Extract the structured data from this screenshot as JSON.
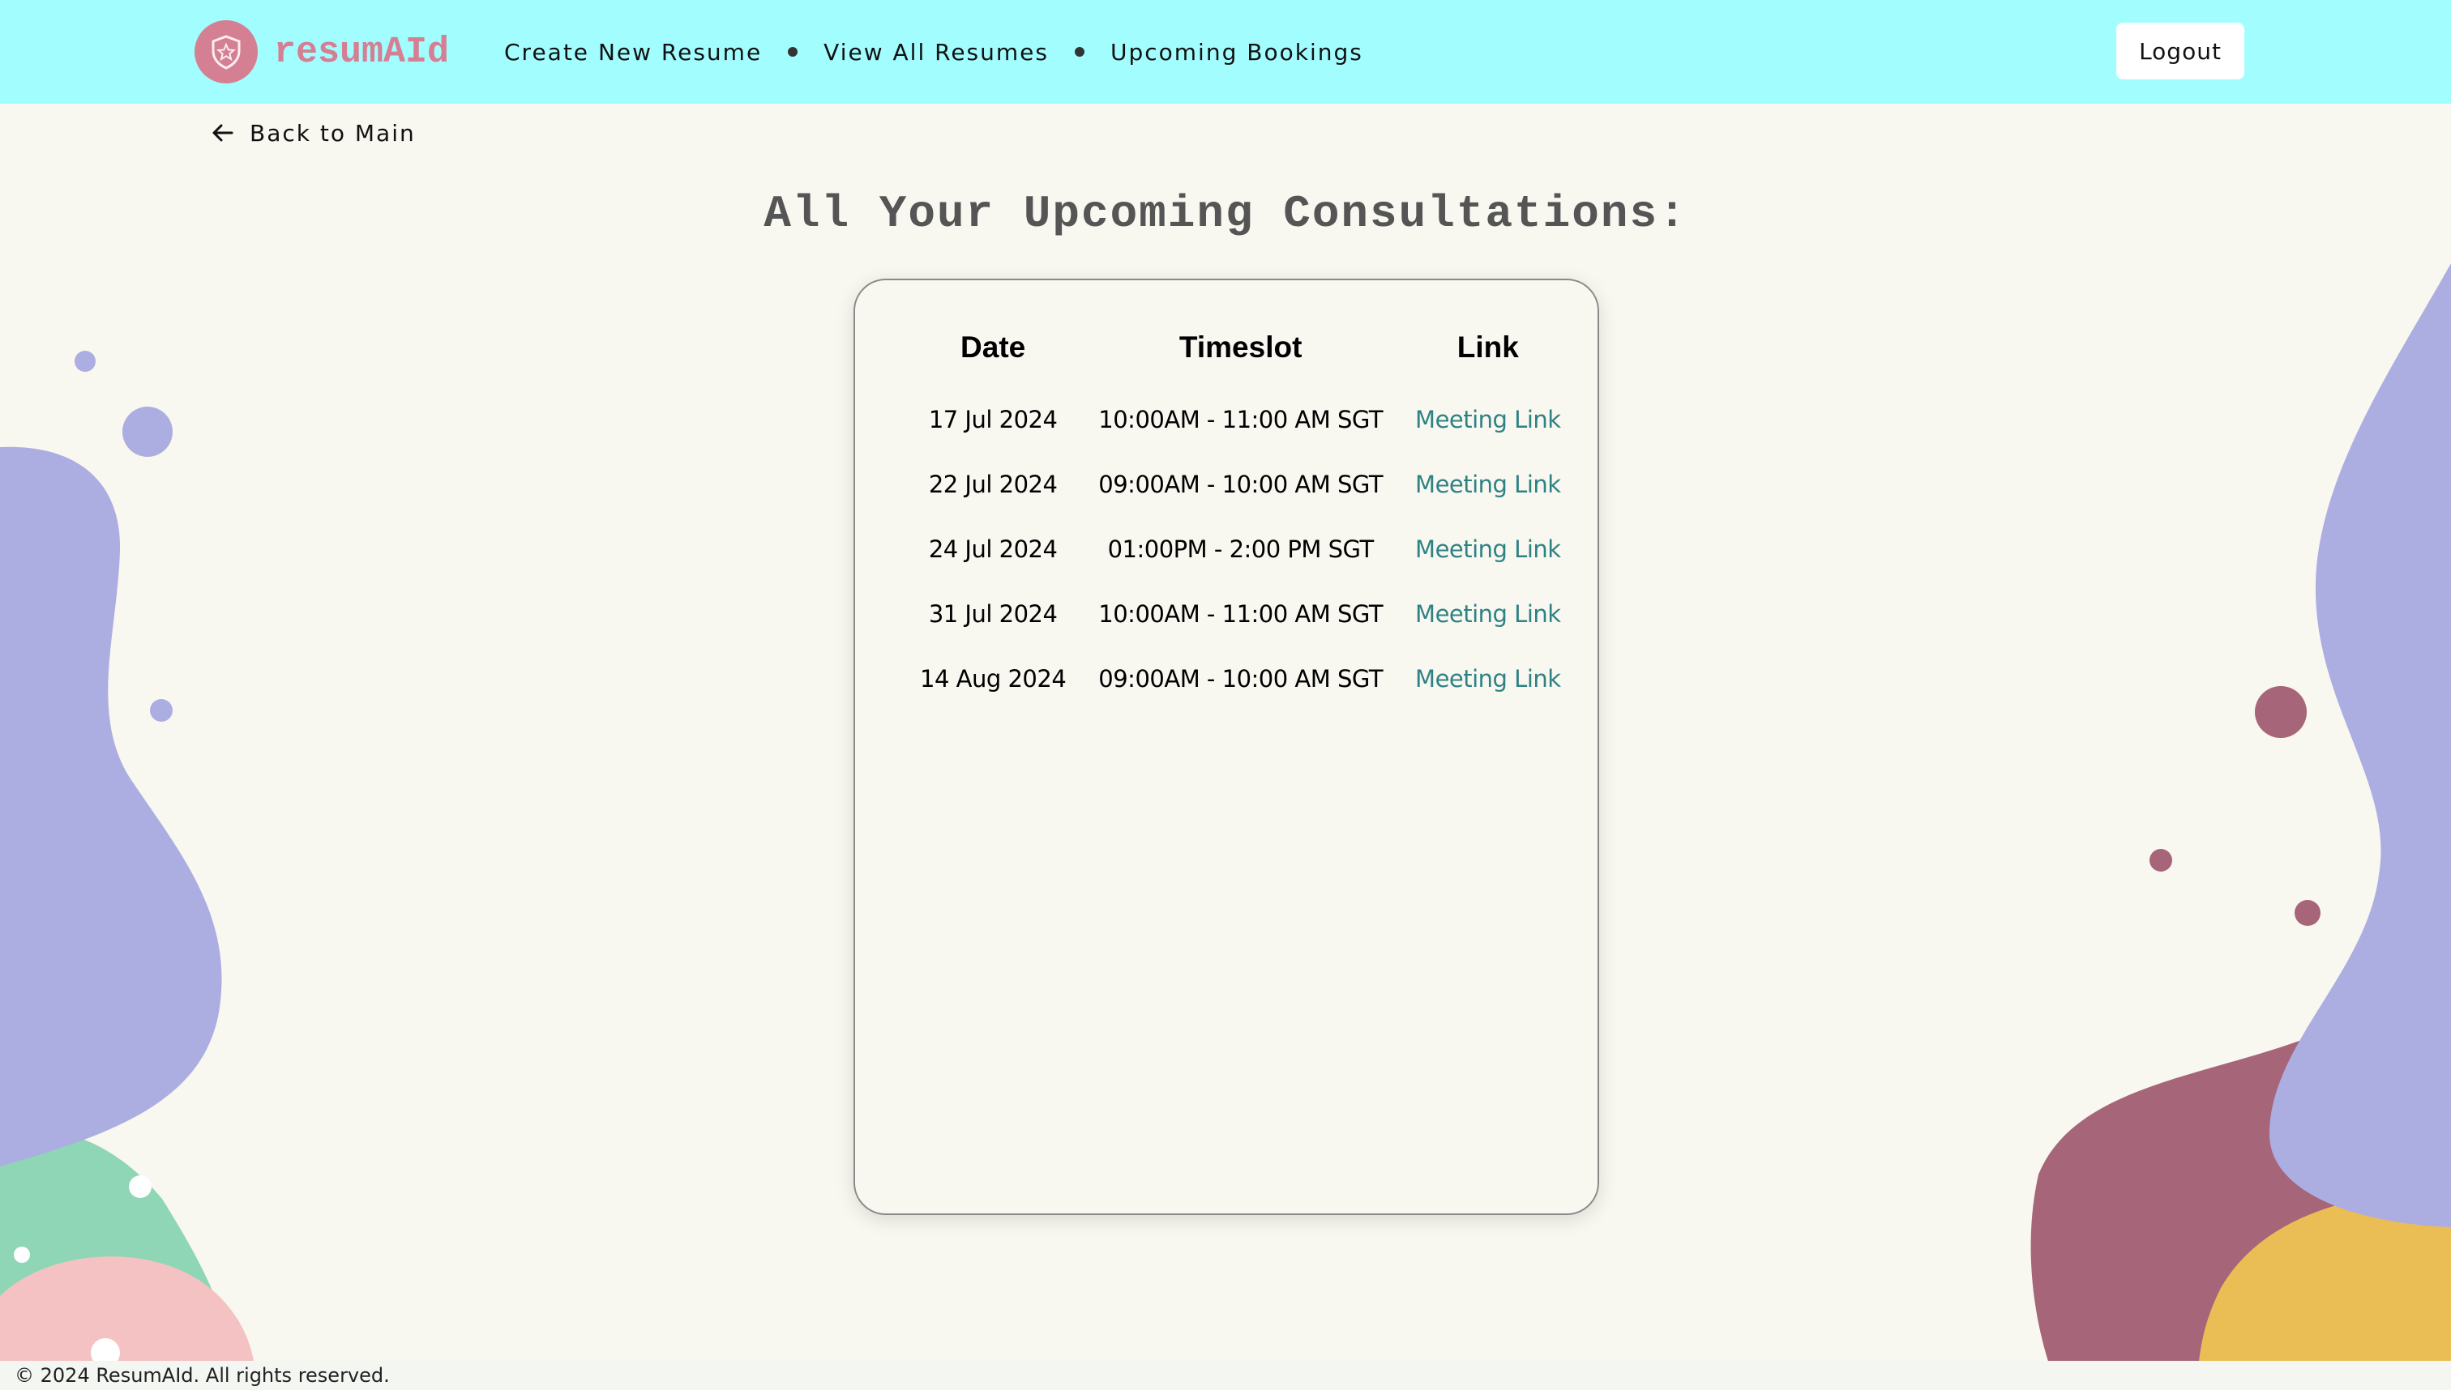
{
  "brand": {
    "name": "resumAId",
    "accent": "#d47f92",
    "logo_icon": "shield-star-icon"
  },
  "nav": {
    "links": [
      "Create New Resume",
      "View All Resumes",
      "Upcoming Bookings"
    ],
    "logout_label": "Logout",
    "background": "#a2fdff"
  },
  "back": {
    "label": "Back to Main",
    "icon": "arrow-left-icon"
  },
  "page": {
    "title": "All Your Upcoming Consultations:"
  },
  "bookings": {
    "headers": [
      "Date",
      "Timeslot",
      "Link"
    ],
    "rows": [
      {
        "date": "17 Jul 2024",
        "timeslot": "10:00AM - 11:00 AM SGT",
        "link": "Meeting Link"
      },
      {
        "date": "22 Jul 2024",
        "timeslot": "09:00AM - 10:00 AM SGT",
        "link": "Meeting Link"
      },
      {
        "date": "24 Jul 2024",
        "timeslot": "01:00PM - 2:00 PM SGT",
        "link": "Meeting Link"
      },
      {
        "date": "31 Jul 2024",
        "timeslot": "10:00AM - 11:00 AM SGT",
        "link": "Meeting Link"
      },
      {
        "date": "14 Aug 2024",
        "timeslot": "09:00AM - 10:00 AM SGT",
        "link": "Meeting Link"
      }
    ],
    "link_color": "#2e8284"
  },
  "footer": {
    "text": "© 2024 ResumAId. All rights reserved."
  },
  "colors": {
    "lavender": "#acaee2",
    "mauve": "#a66578",
    "mint": "#8fd6b6",
    "pink": "#f4c2c2",
    "gold": "#eabd55",
    "background": "#f8f7f0"
  }
}
